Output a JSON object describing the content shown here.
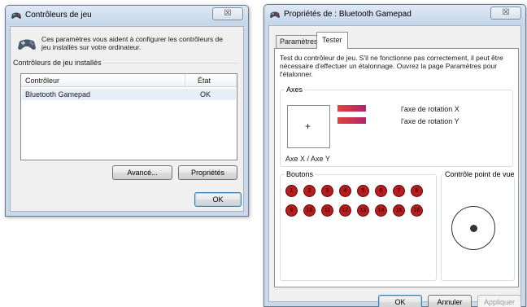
{
  "left_window": {
    "title": "Contrôleurs de jeu",
    "close_label": "☒",
    "description": "Ces paramètres vous aident à configurer les contrôleurs de jeu installés sur votre ordinateur.",
    "group_label": "Contrôleurs de jeu installés",
    "table": {
      "columns": [
        "Contrôleur",
        "État"
      ],
      "rows": [
        {
          "controller": "Bluetooth Gamepad",
          "state": "OK"
        }
      ]
    },
    "advanced_button": "Avancé...",
    "properties_button": "Propriétés",
    "ok_button": "OK"
  },
  "right_window": {
    "title": "Propriétés de : Bluetooth Gamepad",
    "close_label": "☒",
    "tabs": [
      {
        "label": "Paramètres",
        "active": false
      },
      {
        "label": "Tester",
        "active": true
      }
    ],
    "instructions": "Test du contrôleur de jeu. S'il ne fonctionne pas correctement, il peut être nécessaire d'effectuer un étalonnage. Ouvrez la page Paramètres pour l'étalonner.",
    "axes": {
      "label": "Axes",
      "xy_label": "Axe X / Axe Y",
      "crosshair": "+",
      "rotation_x": "l'axe de rotation X",
      "rotation_y": "l'axe de rotation Y"
    },
    "buttons": {
      "label": "Boutons",
      "items": [
        "1",
        "2",
        "3",
        "4",
        "5",
        "6",
        "7",
        "8",
        "9",
        "10",
        "11",
        "12",
        "13",
        "14",
        "15",
        "16"
      ]
    },
    "pov": {
      "label": "Contrôle point de vue"
    },
    "ok_button": "OK",
    "cancel_button": "Annuler",
    "apply_button": "Appliquer"
  },
  "colors": {
    "pressed_button_fill": "#b81c1c",
    "axis_bar": "#b2246a",
    "axis_bar_edge": "#e0443c",
    "selected_row": "#e6eef8"
  }
}
